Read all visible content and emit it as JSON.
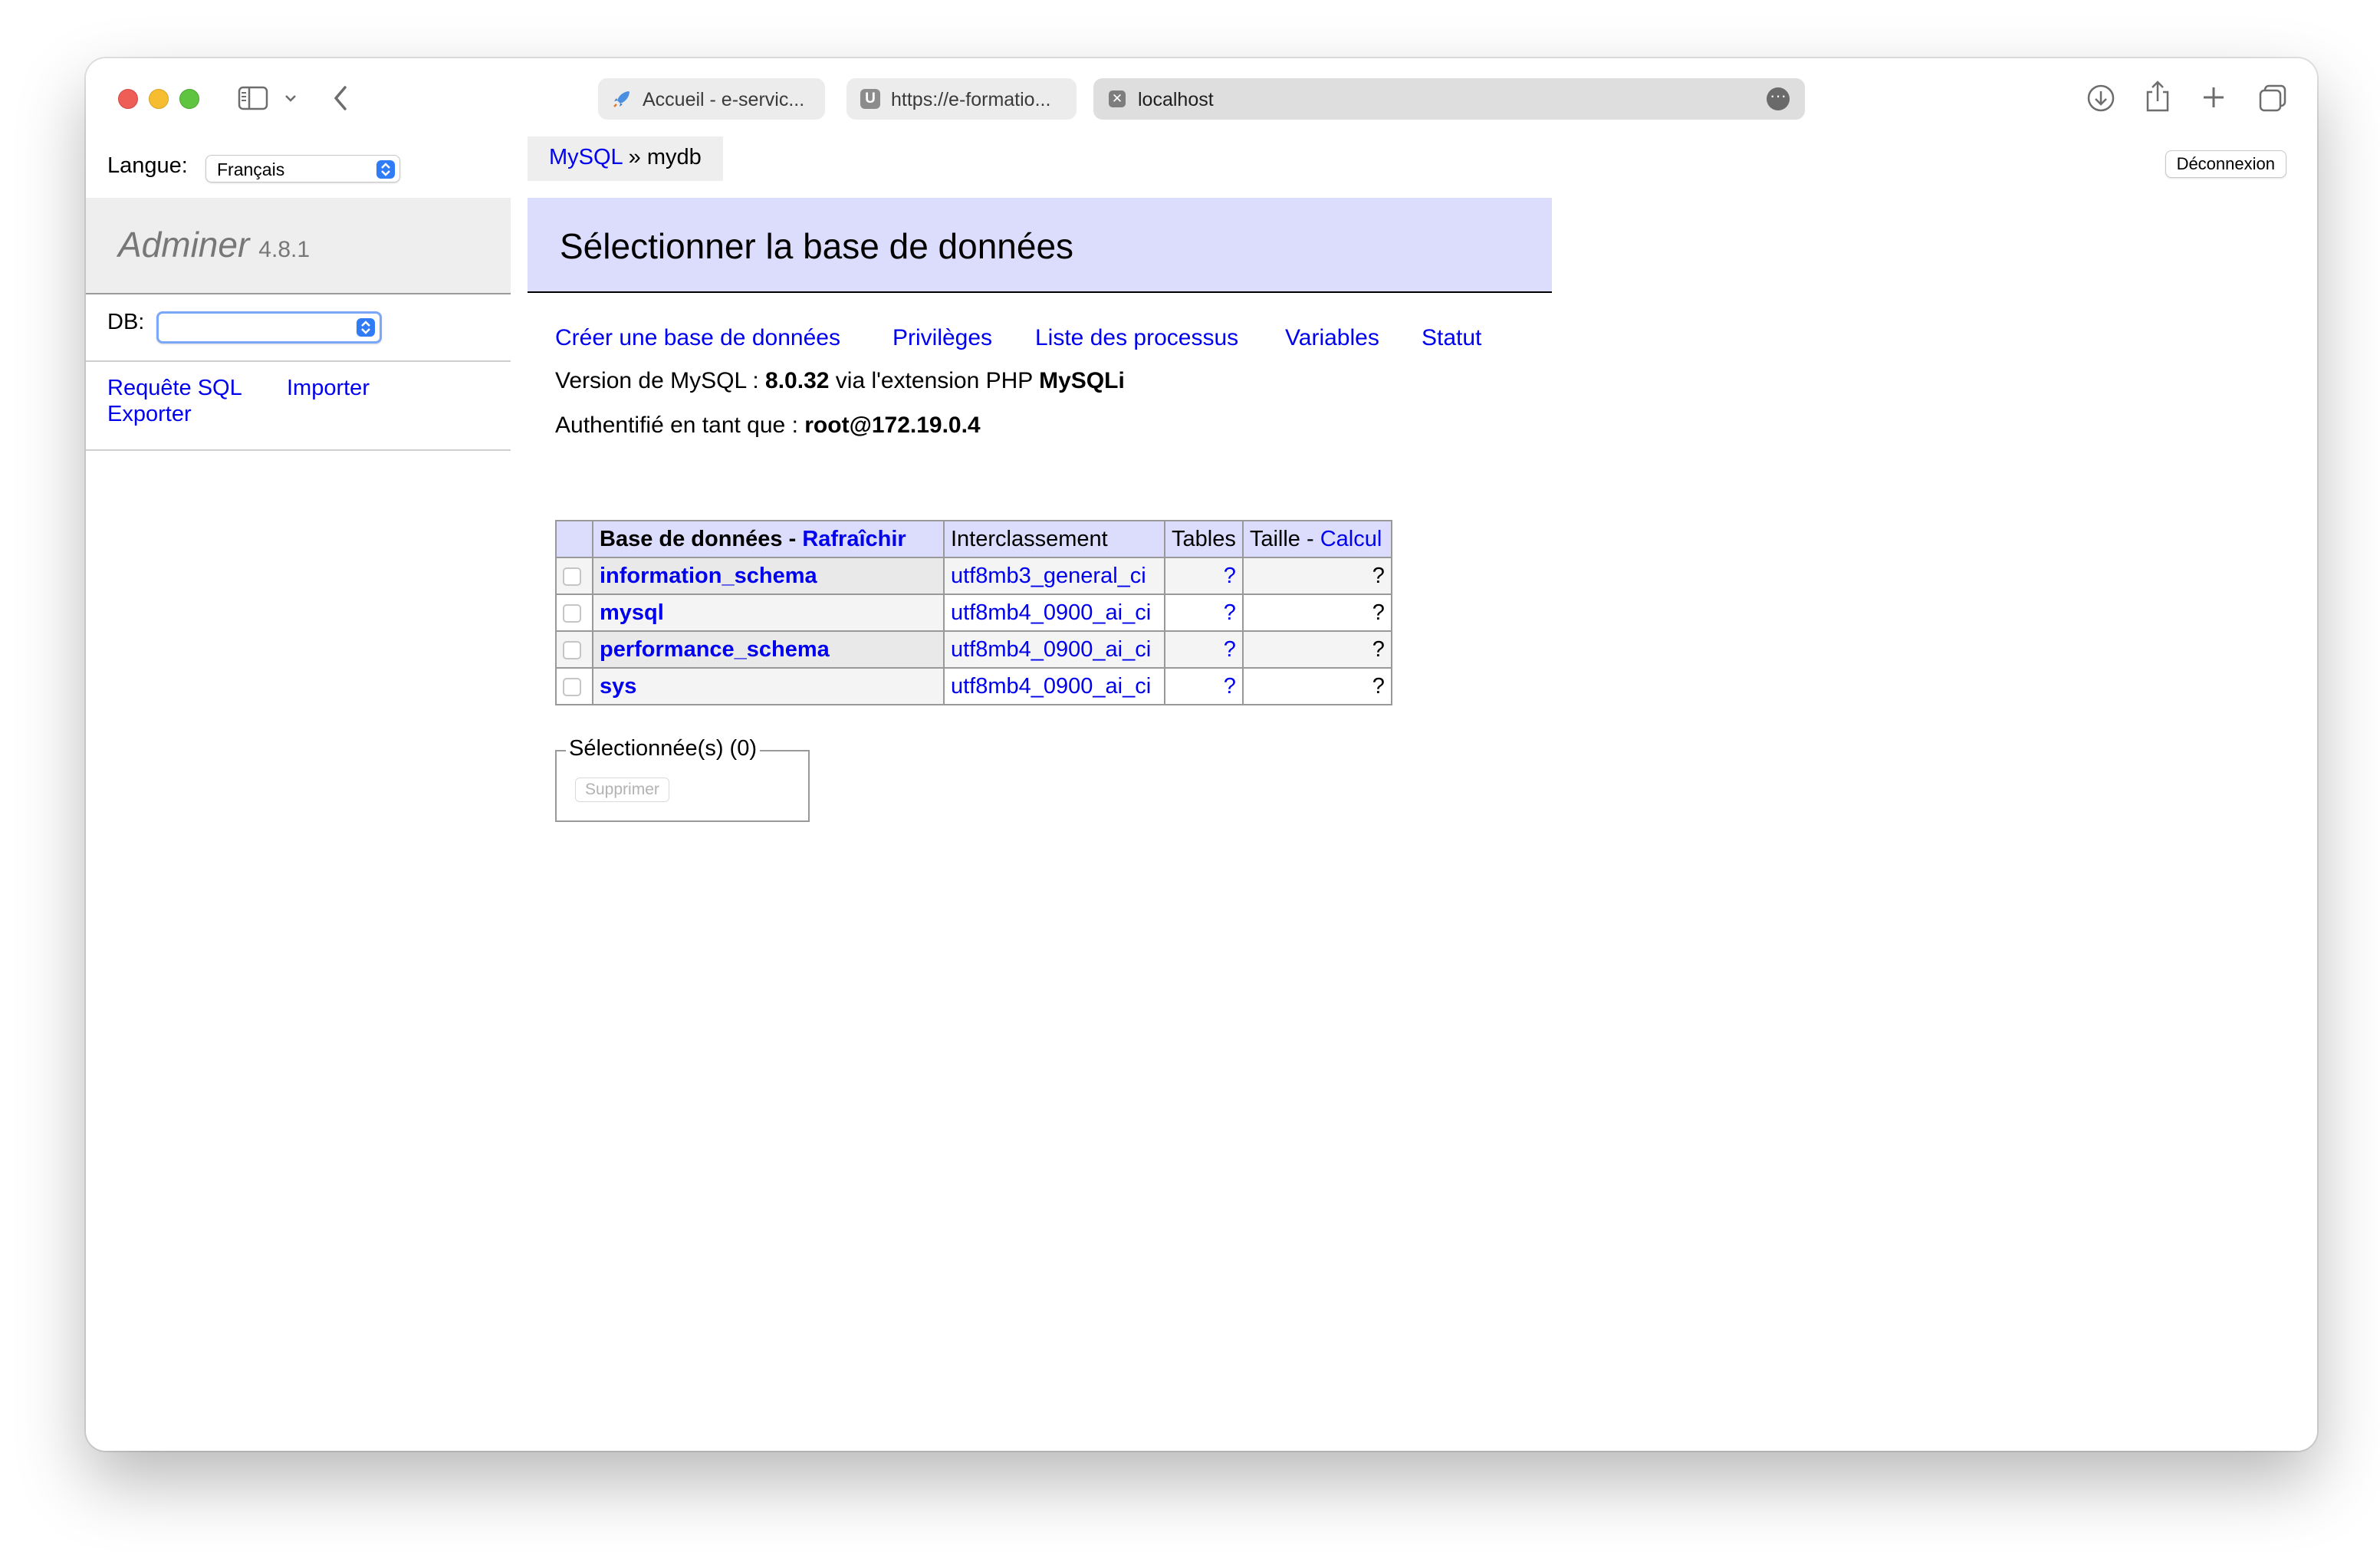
{
  "browser": {
    "tabs": [
      {
        "title": "Accueil - e-servic..."
      },
      {
        "title": "https://e-formatio..."
      },
      {
        "title": "localhost"
      }
    ],
    "colors": {
      "accent": "#2f7cf6",
      "link": "#0000ee"
    }
  },
  "sidebar": {
    "lang_label": "Langue:",
    "lang_value": "Français",
    "app_name": "Adminer",
    "app_version": "4.8.1",
    "db_label": "DB:",
    "db_value": "",
    "links": {
      "sql": "Requête SQL",
      "import": "Importer",
      "export": "Exporter"
    }
  },
  "header": {
    "crumb_link": "MySQL",
    "crumb_sep": "»",
    "crumb_current": "mydb",
    "logout": "Déconnexion"
  },
  "main": {
    "title": "Sélectionner la base de données",
    "menu": {
      "create": "Créer une base de données",
      "privileges": "Privilèges",
      "processes": "Liste des processus",
      "variables": "Variables",
      "status": "Statut"
    },
    "version": {
      "pre": "Version de MySQL :",
      "value": "8.0.32",
      "mid": "via l'extension PHP",
      "ext": "MySQLi"
    },
    "auth": {
      "pre": "Authentifié en tant que :",
      "value": "root@172.19.0.4"
    },
    "table": {
      "headers": {
        "db": "Base de données",
        "sep": "-",
        "refresh": "Rafraîchir",
        "collation": "Interclassement",
        "tables": "Tables",
        "size": "Taille",
        "compute": "Calcul"
      },
      "rows": [
        {
          "name": "information_schema",
          "collation": "utf8mb3_general_ci",
          "tables": "?",
          "size": "?"
        },
        {
          "name": "mysql",
          "collation": "utf8mb4_0900_ai_ci",
          "tables": "?",
          "size": "?"
        },
        {
          "name": "performance_schema",
          "collation": "utf8mb4_0900_ai_ci",
          "tables": "?",
          "size": "?"
        },
        {
          "name": "sys",
          "collation": "utf8mb4_0900_ai_ci",
          "tables": "?",
          "size": "?"
        }
      ]
    },
    "selected": {
      "legend": "Sélectionnée(s) (0)",
      "delete": "Supprimer"
    }
  }
}
